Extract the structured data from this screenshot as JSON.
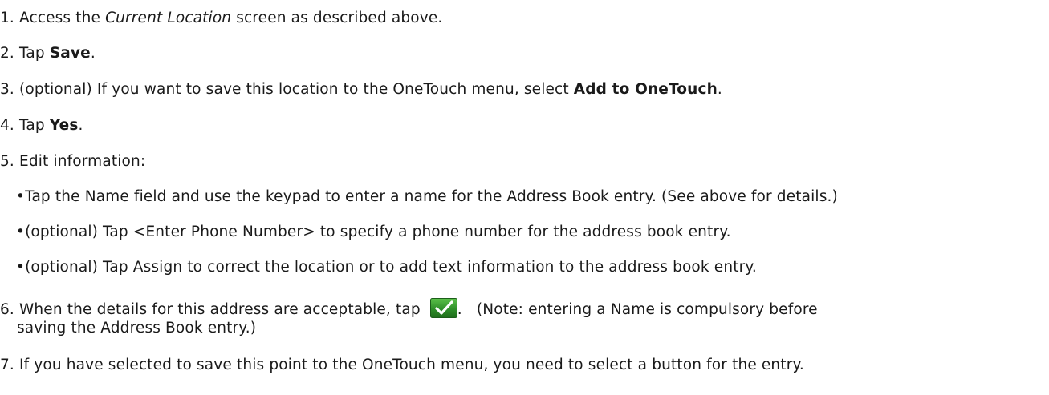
{
  "steps": [
    {
      "number": "1.",
      "before": "Access the ",
      "italic": "Current Location",
      "after": " screen as described above."
    },
    {
      "number": "2.",
      "before": "Tap ",
      "bold": "Save",
      "after": "."
    },
    {
      "number": "3.",
      "before": "(optional) If you want to save this location to the OneTouch menu, select ",
      "bold": "Add to OneTouch",
      "after": "."
    },
    {
      "number": "4.",
      "before": "Tap ",
      "bold": "Yes",
      "after": "."
    },
    {
      "number": "5.",
      "text": "Edit information:"
    },
    {
      "number": "6.",
      "before": "When the details for this address are acceptable, tap ",
      "after": ".   (Note: entering a Name is compulsory before",
      "continuation": "saving the Address Book entry.)"
    },
    {
      "number": "7.",
      "text": "If you have selected to save this point to the OneTouch menu, you need to select a button for the entry."
    }
  ],
  "bullets": [
    {
      "symbol": "•",
      "text": "Tap the Name field and use the keypad to enter a name for the Address Book entry. (See above for details.)"
    },
    {
      "symbol": "•",
      "text": "(optional) Tap <Enter Phone Number> to specify a phone number for the address book entry."
    },
    {
      "symbol": "•",
      "text": "(optional) Tap Assign to correct the location or to add text information to the address book entry."
    }
  ],
  "icons": {
    "confirm": "checkmark-icon"
  },
  "colors": {
    "text": "#1a1a1a",
    "confirm_button": "#2f8f2a",
    "checkmark": "#ffffff"
  }
}
